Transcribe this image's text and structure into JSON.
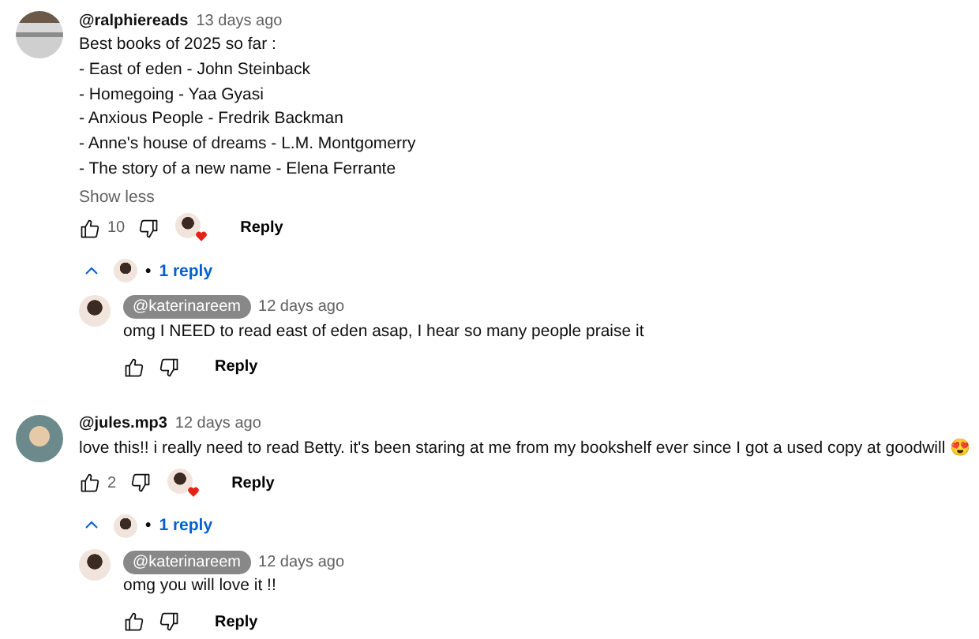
{
  "comments": [
    {
      "author": "@ralphiereads",
      "time": "13 days ago",
      "lines": [
        "Best books of 2025 so far :",
        "- East of eden - John Steinback",
        "- Homegoing - Yaa Gyasi",
        "- Anxious People - Fredrik Backman",
        "- Anne's house of dreams - L.M. Montgomerry",
        "- The story of a new name - Elena Ferrante"
      ],
      "show_less": "Show less",
      "likes": "10",
      "hearted": true,
      "reply_button": "Reply",
      "replies_toggle": {
        "separator": "•",
        "label": "1 reply",
        "expanded": true
      },
      "replies": [
        {
          "author": "@katerinareem",
          "creator": true,
          "time": "12 days ago",
          "lines": [
            "omg I NEED to read east of eden asap, I hear so many people praise it"
          ],
          "reply_button": "Reply"
        }
      ]
    },
    {
      "author": "@jules.mp3",
      "time": "12 days ago",
      "lines": [
        "love this!! i really need to read Betty. it's been staring at me from my bookshelf ever since I got a used copy at goodwill 😍"
      ],
      "likes": "2",
      "hearted": true,
      "reply_button": "Reply",
      "replies_toggle": {
        "separator": "•",
        "label": "1 reply",
        "expanded": true
      },
      "replies": [
        {
          "author": "@katerinareem",
          "creator": true,
          "time": "12 days ago",
          "lines": [
            "omg you will love it !!"
          ],
          "reply_button": "Reply"
        }
      ]
    }
  ]
}
